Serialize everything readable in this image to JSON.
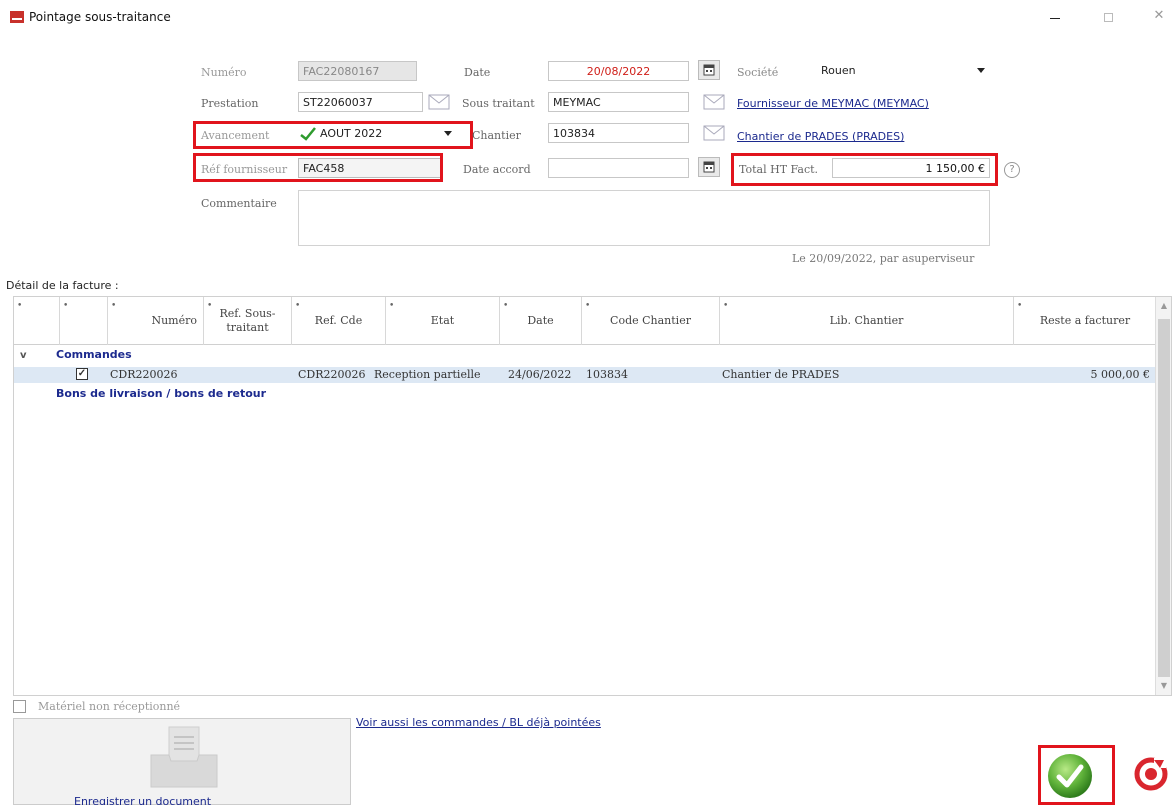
{
  "window": {
    "title": "Pointage sous-traitance",
    "close_glyph": "✕"
  },
  "form": {
    "numero_label": "Numéro",
    "numero_value": "FAC22080167",
    "date_label": "Date",
    "date_value": "20/08/2022",
    "societe_label": "Société",
    "societe_value": "Rouen",
    "prestation_label": "Prestation",
    "prestation_value": "ST22060037",
    "sous_traitant_label": "Sous traitant",
    "sous_traitant_value": "MEYMAC",
    "fournisseur_link": "Fournisseur de MEYMAC (MEYMAC)",
    "avancement_label": "Avancement",
    "avancement_value": "AOUT 2022",
    "chantier_label": "Chantier",
    "chantier_value": "103834",
    "chantier_link": "Chantier de PRADES (PRADES)",
    "ref_fournisseur_label": "Réf fournisseur",
    "ref_fournisseur_value": "FAC458",
    "date_accord_label": "Date accord",
    "date_accord_value": "",
    "total_ht_label": "Total HT Fact.",
    "total_ht_value": "1 150,00 €",
    "commentaire_label": "Commentaire",
    "commentaire_value": "",
    "stamp": "Le 20/09/2022, par asuperviseur",
    "help_glyph": "?"
  },
  "grid": {
    "section_title": "Détail de la facture :",
    "columns": [
      {
        "label": "",
        "dot": "•"
      },
      {
        "label": "",
        "dot": "•"
      },
      {
        "label": "Numéro",
        "dot": "•"
      },
      {
        "label": "Ref. Sous-traitant",
        "dot": "•"
      },
      {
        "label": "Ref. Cde",
        "dot": "•"
      },
      {
        "label": "Etat",
        "dot": "•"
      },
      {
        "label": "Date",
        "dot": "•"
      },
      {
        "label": "Code Chantier",
        "dot": "•"
      },
      {
        "label": "Lib. Chantier",
        "dot": "•"
      },
      {
        "label": "Reste a facturer",
        "dot": "•"
      }
    ],
    "group_commandes": "Commandes",
    "group_bons": "Bons de livraison / bons de retour",
    "expander_glyph": "v",
    "check_glyph": "✓",
    "row": {
      "numero": "CDR220026",
      "ref_cde": "CDR220026",
      "etat": "Reception partielle",
      "date": "24/06/2022",
      "code_chantier": "103834",
      "lib_chantier": "Chantier de PRADES",
      "reste": "5 000,00 €"
    },
    "scroll_up_glyph": "▲",
    "scroll_down_glyph": "▼"
  },
  "footer": {
    "materiel_label": "Matériel non réceptionné",
    "see_also_link": "Voir aussi les commandes / BL déjà pointées",
    "doc_label": "Enregistrer un document"
  }
}
